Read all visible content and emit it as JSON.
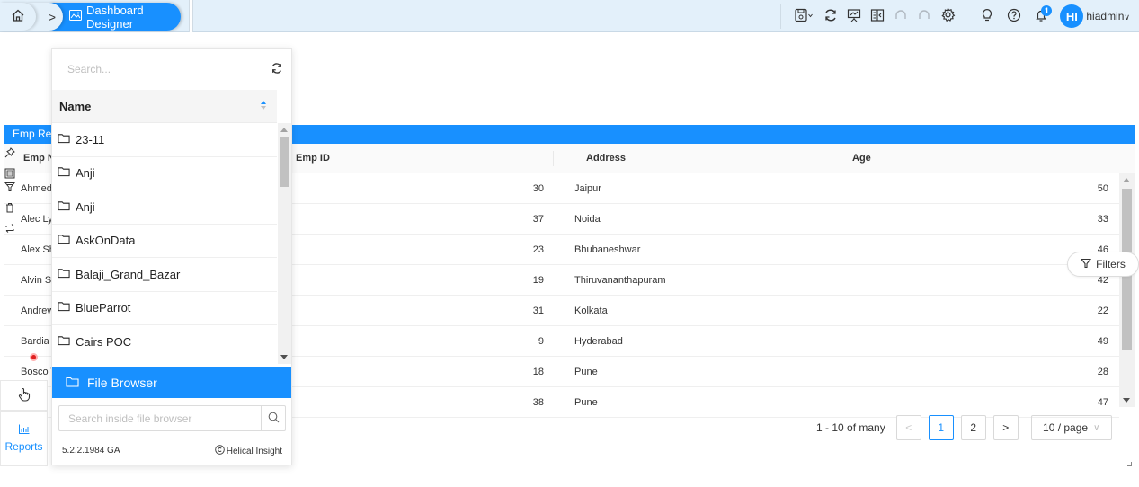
{
  "topbar": {
    "breadcrumb_active": "Dashboard Designer",
    "user": {
      "initials": "HI",
      "name": "hiadmin"
    },
    "notification_count": "1",
    "icons": [
      "save-menu-icon",
      "refresh-icon",
      "presentation-icon",
      "panel-toggle-icon",
      "undo-icon",
      "redo-icon",
      "settings-icon",
      "lightbulb-icon",
      "help-icon",
      "notification-bell-icon"
    ]
  },
  "report": {
    "title": "Emp Re",
    "columns": [
      "Emp Na",
      "Emp ID",
      "Address",
      "Age"
    ],
    "rows": [
      {
        "name": "Ahmed",
        "emp_id": "30",
        "address": "Jaipur",
        "age": "50"
      },
      {
        "name": "Alec Ly",
        "emp_id": "37",
        "address": "Noida",
        "age": "33"
      },
      {
        "name": "Alex Sh",
        "emp_id": "23",
        "address": "Bhubaneshwar",
        "age": "46"
      },
      {
        "name": "Alvin Si",
        "emp_id": "19",
        "address": "Thiruvananthapuram",
        "age": "42"
      },
      {
        "name": "Andrew",
        "emp_id": "31",
        "address": "Kolkata",
        "age": "22"
      },
      {
        "name": "Bardia",
        "emp_id": "9",
        "address": "Hyderabad",
        "age": "49"
      },
      {
        "name": "Bosco T",
        "emp_id": "18",
        "address": "Pune",
        "age": "28"
      },
      {
        "name": "",
        "emp_id": "38",
        "address": "Pune",
        "age": "47"
      }
    ],
    "filters_label": "Filters",
    "pagination": {
      "summary": "1 - 10 of many",
      "prev": "<",
      "pages": [
        "1",
        "2"
      ],
      "current_page": "1",
      "next": ">",
      "page_size": "10 / page"
    }
  },
  "side": {
    "reports_label": "Reports"
  },
  "file_browser": {
    "search_placeholder": "Search...",
    "name_header": "Name",
    "items": [
      "23-11",
      "Anji",
      "Anji",
      "AskOnData",
      "Balaji_Grand_Bazar",
      "BlueParrot",
      "Cairs POC"
    ],
    "footer_button": "File Browser",
    "inner_search_placeholder": "Search inside file browser",
    "version": "5.2.2.1984 GA",
    "brand": "Helical Insight"
  },
  "colors": {
    "accent": "#1890ff",
    "topbar_bg": "#e3f0fa"
  }
}
